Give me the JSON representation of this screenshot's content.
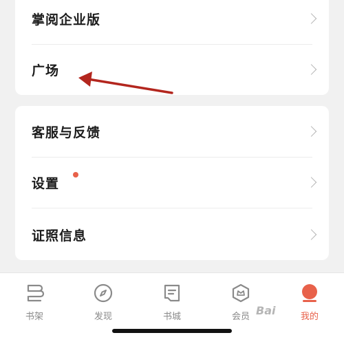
{
  "menu_group_1": {
    "items": [
      {
        "label": "掌阅企业版"
      },
      {
        "label": "广场"
      }
    ]
  },
  "menu_group_2": {
    "items": [
      {
        "label": "客服与反馈"
      },
      {
        "label": "设置"
      },
      {
        "label": "证照信息"
      }
    ]
  },
  "colors": {
    "accent": "#e8614a",
    "annotation_arrow": "#b3261e",
    "tab_inactive": "#8a8a8a"
  },
  "tabbar": {
    "tabs": [
      {
        "label": "书架",
        "icon": "bookshelf-icon",
        "active": false
      },
      {
        "label": "发现",
        "icon": "compass-icon",
        "active": false
      },
      {
        "label": "书城",
        "icon": "book-icon",
        "active": false
      },
      {
        "label": "会员",
        "icon": "vip-shield-icon",
        "active": false
      },
      {
        "label": "我的",
        "icon": "profile-dot-icon",
        "active": true
      }
    ]
  },
  "watermark": "Bai"
}
